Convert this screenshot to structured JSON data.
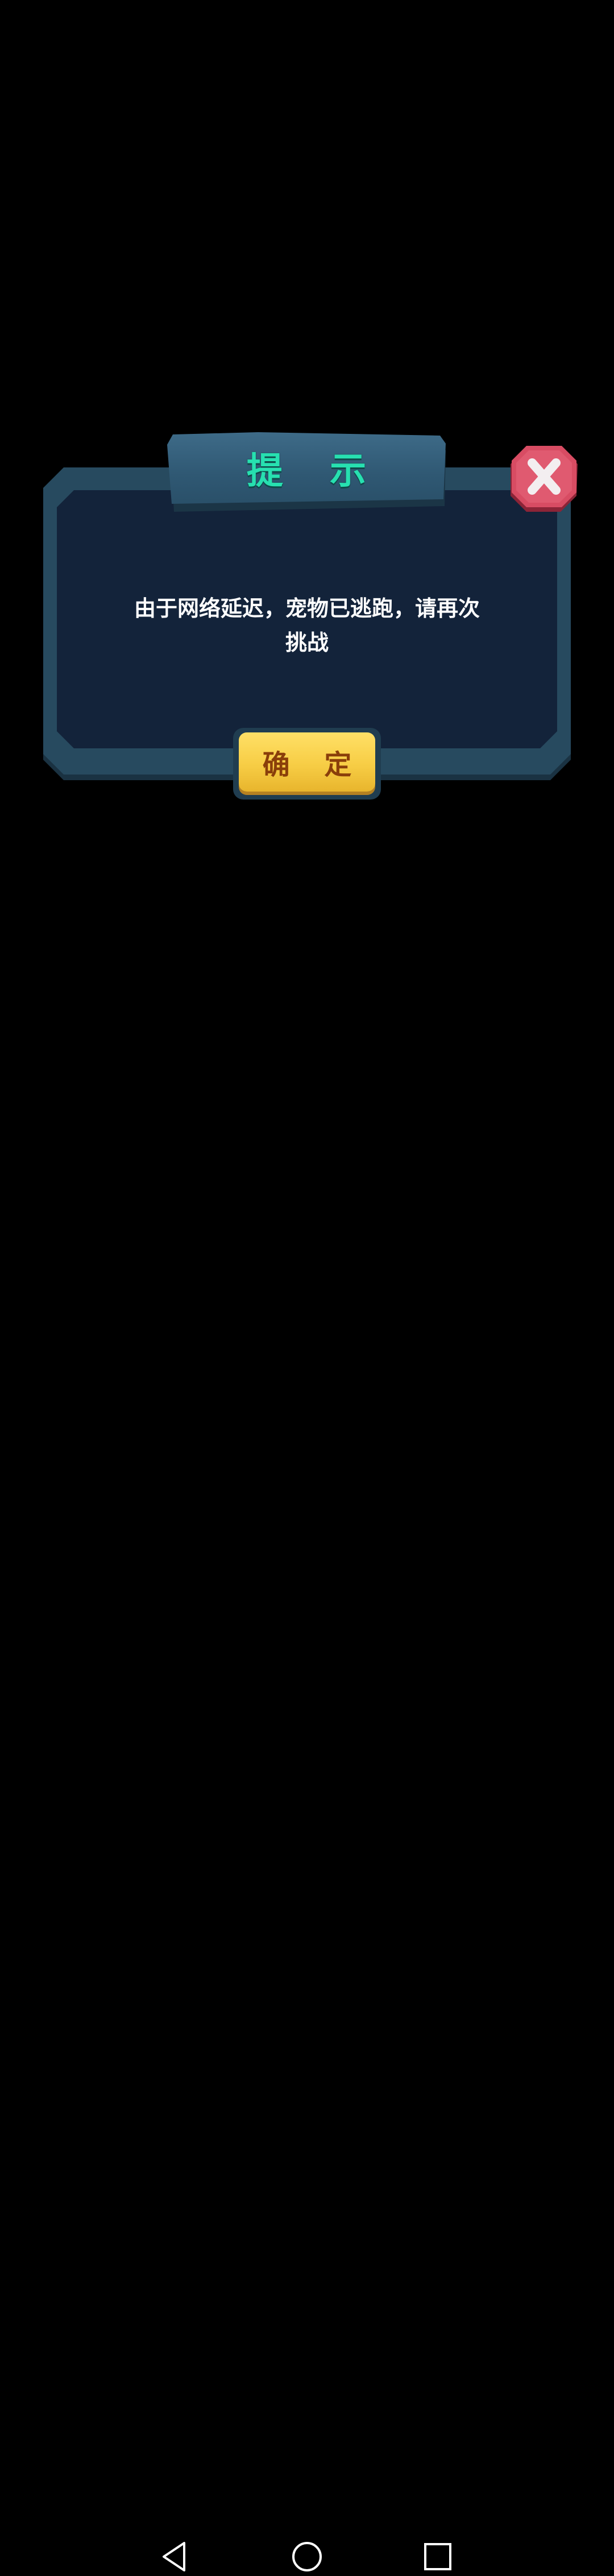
{
  "dialog": {
    "title": "提 示",
    "message_line1": "由于网络延迟，宠物已逃跑，请再次",
    "message_line2": "挑战",
    "confirm_label": "确 定",
    "close_icon": "close-icon"
  },
  "nav": {
    "back_icon": "back-triangle-icon",
    "home_icon": "home-circle-icon",
    "recents_icon": "recents-square-icon"
  },
  "colors": {
    "background": "#000000",
    "frame": "#274a5f",
    "panel": "#13233a",
    "title_text": "#27e0b0",
    "confirm_button": "#f7cd45",
    "confirm_text": "#8a3f0a",
    "close_button": "#d84c63"
  }
}
